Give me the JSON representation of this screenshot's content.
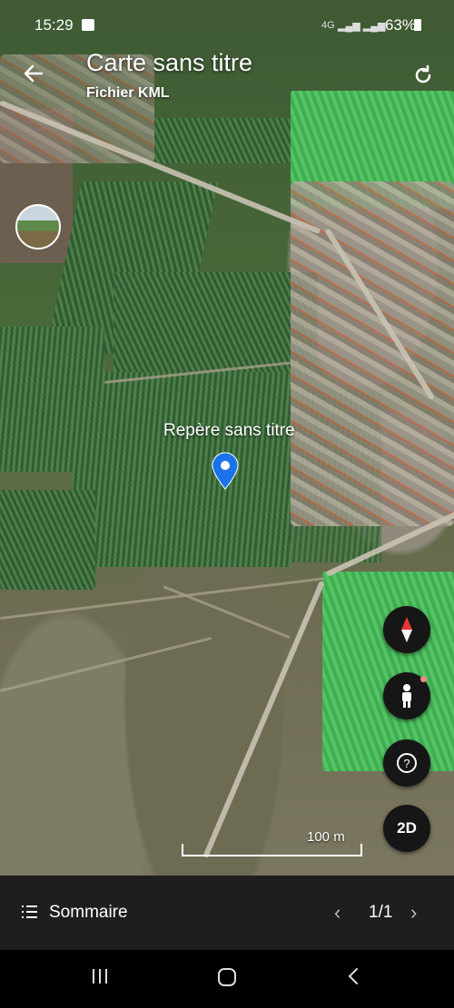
{
  "status_bar": {
    "time": "15:29",
    "network": "4G",
    "battery": "63%"
  },
  "header": {
    "title": "Carte sans titre",
    "subtitle": "Fichier KML"
  },
  "map": {
    "placemark_label": "Repère sans titre",
    "scale_label": "100 m"
  },
  "controls": {
    "view_mode": "2D"
  },
  "bottom_bar": {
    "summary_label": "Sommaire",
    "page_indicator": "1/1"
  },
  "colors": {
    "pin": "#1a73e8",
    "compass_needle": "#e53935"
  }
}
